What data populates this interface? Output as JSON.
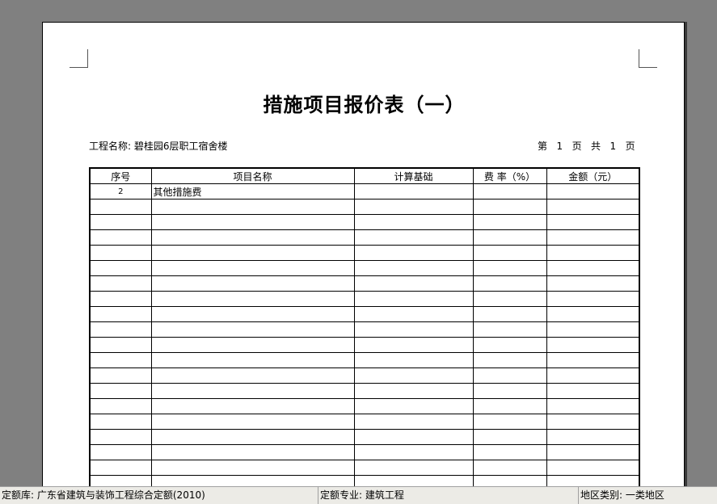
{
  "report": {
    "title": "措施项目报价表（一）",
    "project_label": "工程名称:",
    "project_name": "碧桂园6层职工宿舍楼",
    "page_prefix": "第",
    "page_current": "1",
    "page_mid1": "页",
    "page_total_label": "共",
    "page_total": "1",
    "page_suffix": "页"
  },
  "table": {
    "headers": {
      "no": "序号",
      "name": "项目名称",
      "basis": "计算基础",
      "rate": "费 率（%）",
      "amount": "金额（元）"
    },
    "rows": [
      {
        "no": "2",
        "name": "其他措施费",
        "basis": "",
        "rate": "",
        "amount": ""
      }
    ],
    "empty_rows": 19
  },
  "statusbar": {
    "quota_db_label": "定额库:",
    "quota_db_value": "广东省建筑与装饰工程综合定额(2010)",
    "discipline_label": "定额专业:",
    "discipline_value": "建筑工程",
    "region_label": "地区类别:",
    "region_value": "一类地区"
  }
}
